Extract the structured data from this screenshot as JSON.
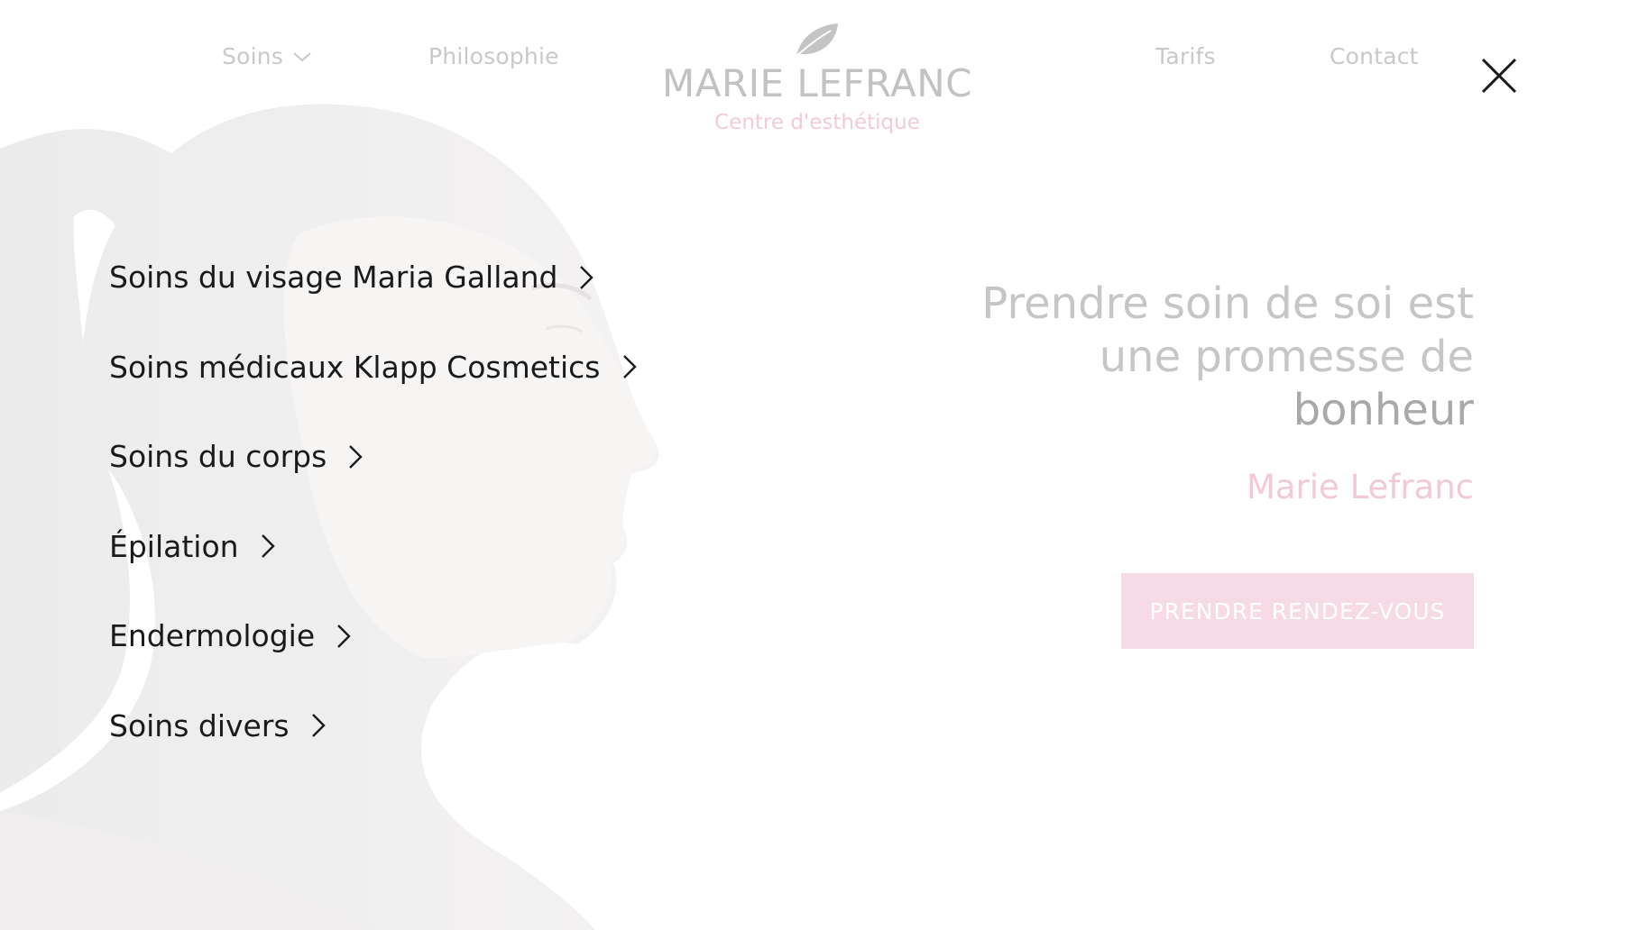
{
  "header": {
    "nav_left": [
      {
        "label": "Soins",
        "has_dropdown": true
      },
      {
        "label": "Philosophie"
      }
    ],
    "nav_right": [
      {
        "label": "Tarifs"
      },
      {
        "label": "Contact"
      }
    ],
    "logo": {
      "name": "MARIE LEFRANC",
      "subtitle": "Centre d'esthétique",
      "icon": "leaf-icon"
    }
  },
  "hero": {
    "tagline_line1": "Prendre soin de soi est",
    "tagline_line2": "une promesse de",
    "tagline_line3": "bonheur",
    "author": "Marie Lefranc",
    "cta_label": "PRENDRE RENDEZ-VOUS"
  },
  "menu": {
    "close_icon": "close-icon",
    "items": [
      {
        "label": "Soins du visage Maria Galland"
      },
      {
        "label": "Soins médicaux Klapp Cosmetics"
      },
      {
        "label": "Soins du corps"
      },
      {
        "label": "Épilation"
      },
      {
        "label": "Endermologie"
      },
      {
        "label": "Soins divers"
      }
    ]
  },
  "colors": {
    "menu_text": "#1a1a1a",
    "faded_nav": "#c9c9c9",
    "pink_accent": "#f2c9d8",
    "cta_bg": "#f6dbe6"
  }
}
